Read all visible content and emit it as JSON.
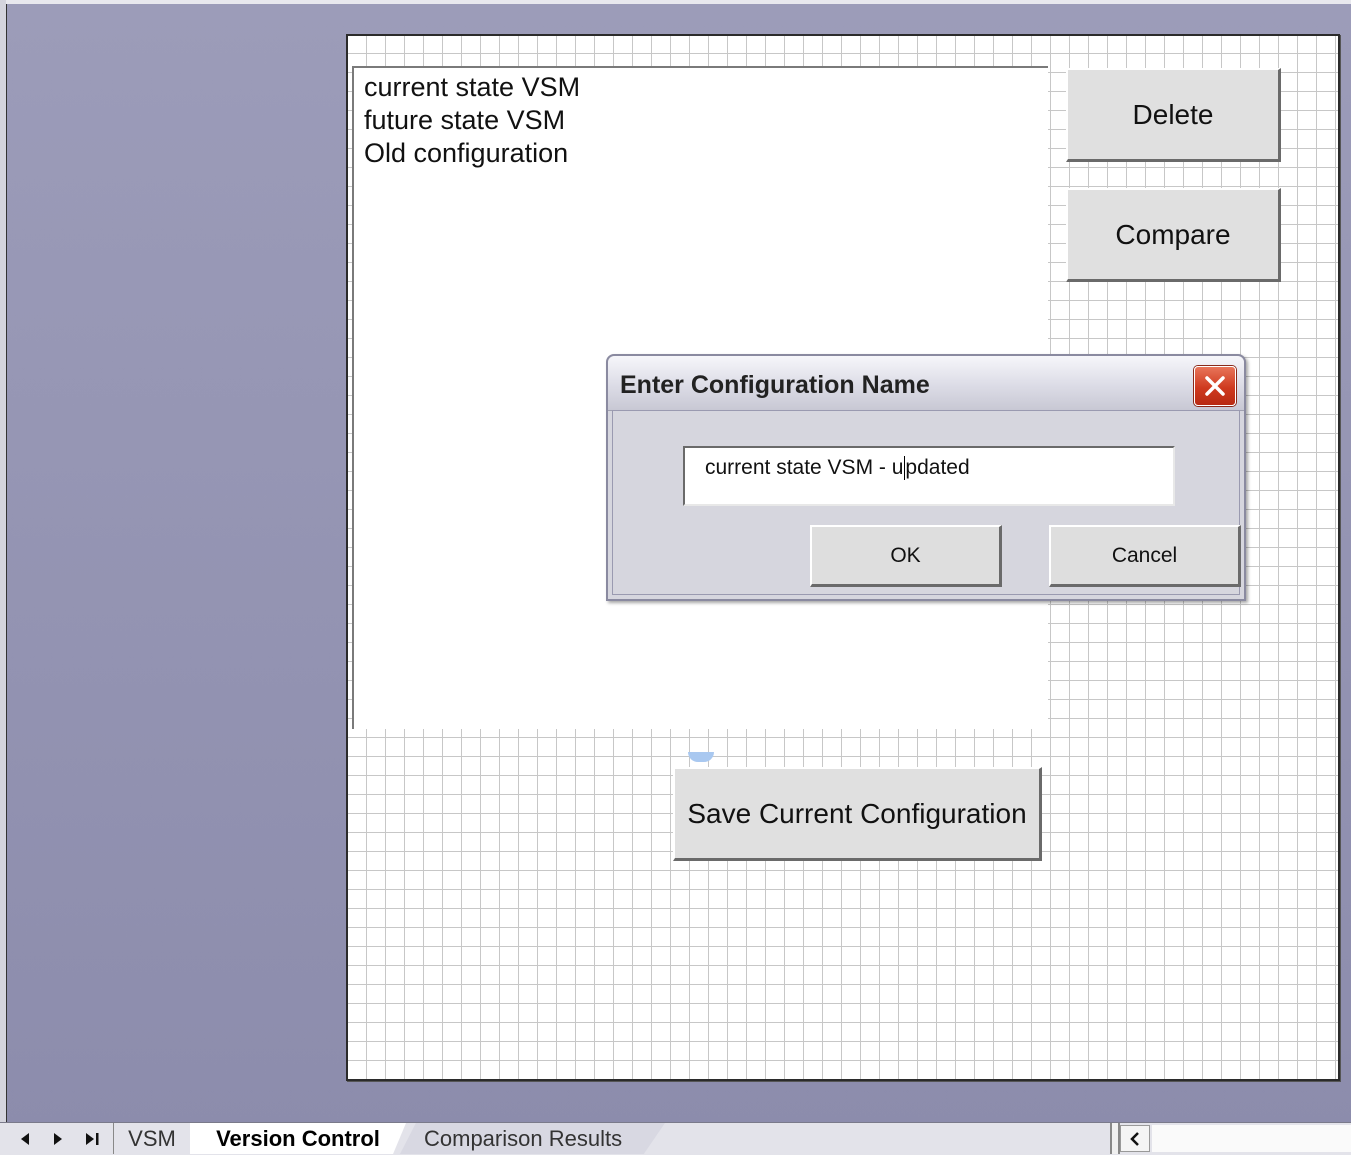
{
  "listbox": {
    "items": [
      "current state VSM",
      "future state VSM",
      "Old configuration"
    ]
  },
  "buttons": {
    "delete": "Delete",
    "compare": "Compare",
    "save_current": "Save Current Configuration"
  },
  "dialog": {
    "title": "Enter Configuration Name",
    "input_value_before_caret": "current state VSM - u",
    "input_value_after_caret": "pdated",
    "ok_label": "OK",
    "cancel_label": "Cancel",
    "close_icon": "close-icon"
  },
  "sheet_tabs": {
    "items": [
      "VSM",
      "Version Control",
      "Comparison Results"
    ],
    "active": "Version Control"
  },
  "colors": {
    "close_button": "#cf3a1f",
    "desktop_background": "#8c8cac"
  }
}
